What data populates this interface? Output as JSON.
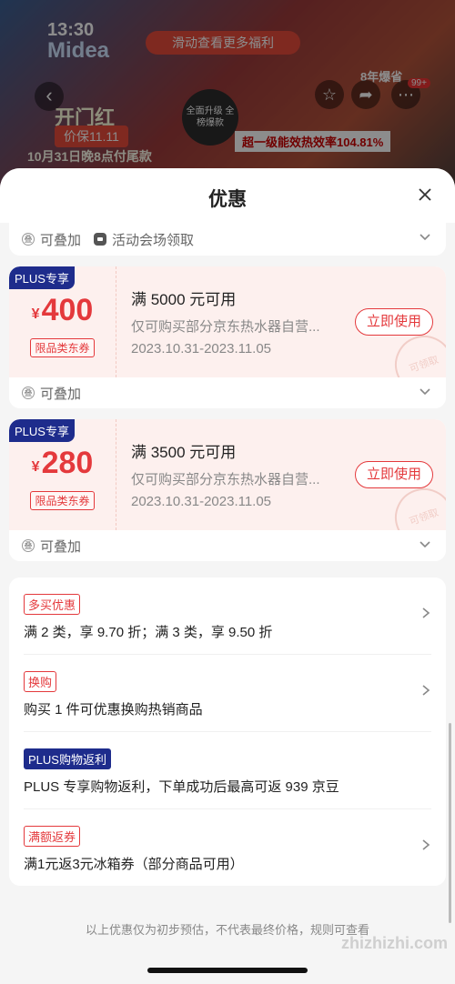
{
  "background": {
    "time": "13:30",
    "brand": "Midea",
    "promo_pill": "滑动查看更多福利",
    "banner_title": "开门红",
    "banner_price": "价保11.11",
    "banner_tail": "10月31日晚8点付尾款",
    "cert_text": "全面升级 全榜爆款",
    "efficiency": "超一级能效热效率104.81%",
    "years": "8年爆省",
    "badge": "99+"
  },
  "sheet": {
    "title": "优惠"
  },
  "first_coupon_footer": {
    "stack": "可叠加",
    "source": "活动会场领取"
  },
  "coupons": [
    {
      "plus_tag": "PLUS专享",
      "currency": "¥",
      "amount": "400",
      "type": "限品类东券",
      "condition": "满 5000 元可用",
      "scope": "仅可购买部分京东热水器自营...",
      "date": "2023.10.31-2023.11.05",
      "button": "立即使用",
      "stamp": "可领取",
      "stack": "可叠加"
    },
    {
      "plus_tag": "PLUS专享",
      "currency": "¥",
      "amount": "280",
      "type": "限品类东券",
      "condition": "满 3500 元可用",
      "scope": "仅可购买部分京东热水器自营...",
      "date": "2023.10.31-2023.11.05",
      "button": "立即使用",
      "stamp": "可领取",
      "stack": "可叠加"
    }
  ],
  "promotions": [
    {
      "tag": "多买优惠",
      "text": "满 2 类，享 9.70 折；满 3 类，享 9.50 折",
      "style": "red"
    },
    {
      "tag": "换购",
      "text": "购买 1 件可优惠换购热销商品",
      "style": "red"
    },
    {
      "tag": "PLUS购物返利",
      "text": "PLUS 专享购物返利，下单成功后最高可返 939 京豆",
      "style": "blue"
    },
    {
      "tag": "满额返券",
      "text": "满1元返3元冰箱券（部分商品可用）",
      "style": "red"
    }
  ],
  "disclaimer": "以上优惠仅为初步预估，不代表最终价格，规则可查看",
  "watermark": "zhizhizhi.com"
}
